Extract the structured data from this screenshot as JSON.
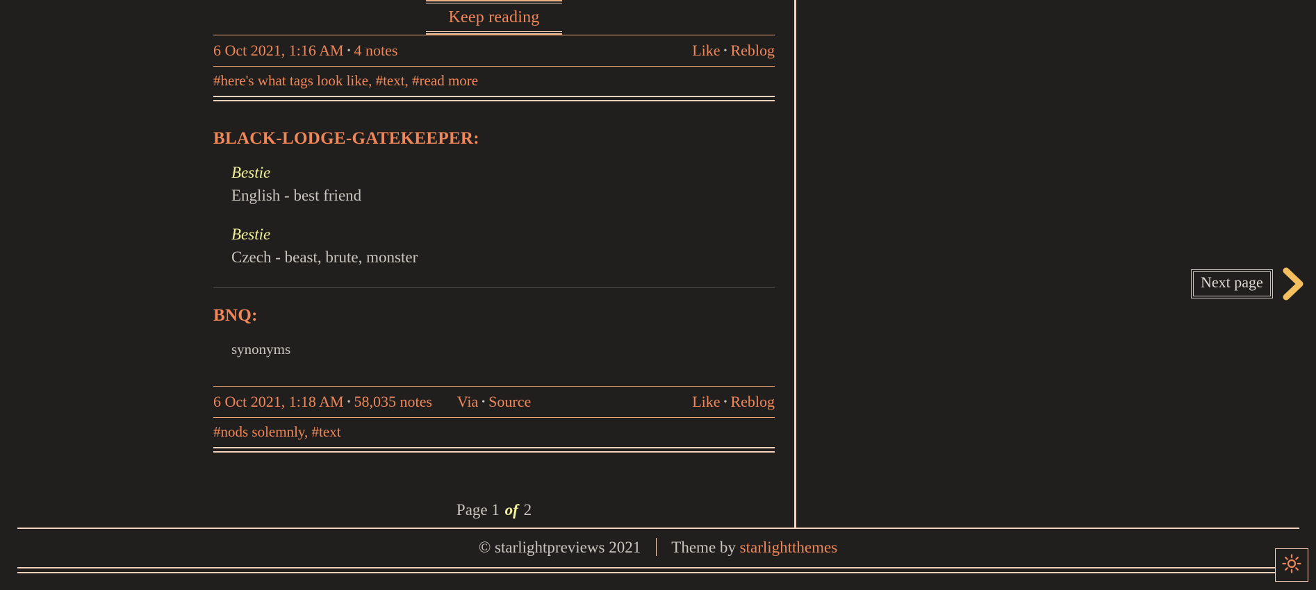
{
  "theme": {
    "background": "#211f1d",
    "accent": "#f0875a",
    "rule": "#f7d3bd",
    "text": "#c9c6bf",
    "highlight": "#f2f29a",
    "chevron": "#f5bf5f"
  },
  "keep_reading": {
    "label": "Keep reading"
  },
  "posts": [
    {
      "meta": {
        "date": "6 Oct 2021, 1:16 AM",
        "bullet": "•",
        "notes": "4 notes",
        "via": "",
        "source": "",
        "like": "Like",
        "reblog": "Reblog"
      },
      "tags": "#here's what tags look like, #text, #read more"
    },
    {
      "title": "BLACK-LODGE-GATEKEEPER:",
      "entries": [
        {
          "term": "Bestie",
          "definition": "English - best friend"
        },
        {
          "term": "Bestie",
          "definition": "Czech - beast, brute, monster"
        }
      ],
      "second_title": "BNQ:",
      "second_body": "synonyms",
      "meta": {
        "date": "6 Oct 2021, 1:18 AM",
        "bullet": "•",
        "notes": "58,035 notes",
        "via": "Via",
        "source": "Source",
        "like": "Like",
        "reblog": "Reblog"
      },
      "tags": "#nods solemnly, #text"
    }
  ],
  "pagination": {
    "page_word": "Page",
    "current": "1",
    "of": "of",
    "total": "2"
  },
  "next_page": {
    "tooltip": "Next page",
    "icon": "chevron-right-icon"
  },
  "footer": {
    "copyright": "© starlightpreviews 2021",
    "theme_credit_prefix": "Theme by ",
    "theme_credit_link": "starlightthemes"
  },
  "theme_toggle": {
    "icon": "sun-icon"
  }
}
